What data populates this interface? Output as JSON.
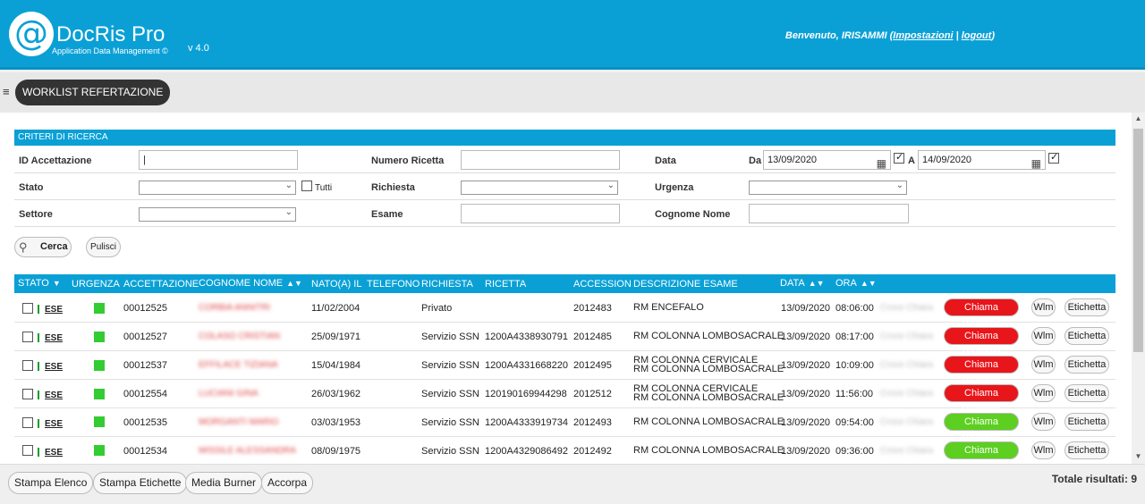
{
  "header": {
    "logo_symbol": "@",
    "app_name": "DocRis Pro",
    "tagline": "Application Data Management ©",
    "version": "v 4.0",
    "welcome_prefix": "Benvenuto, IRISAMMI (",
    "settings_link": "Impostazioni",
    "separator": " | ",
    "logout_link": "logout",
    "welcome_suffix": ")",
    "bg_color": "#0aa0d6"
  },
  "nav": {
    "menu_icon": "hamburger-icon",
    "worklist_label": "WORKLIST REFERTAZIONE"
  },
  "criteria": {
    "title": "CRITERI DI RICERCA",
    "id_accettazione_label": "ID Accettazione",
    "id_accettazione_value": "|",
    "numero_ricetta_label": "Numero Ricetta",
    "numero_ricetta_value": "",
    "data_label": "Data",
    "da_label": "Da",
    "da_value": "13/09/2020",
    "a_label": "A",
    "a_value": "14/09/2020",
    "stato_label": "Stato",
    "stato_value": "",
    "tutti_label": "Tutti",
    "richiesta_label": "Richiesta",
    "richiesta_value": "",
    "urgenza_label": "Urgenza",
    "urgenza_value": "",
    "settore_label": "Settore",
    "settore_value": "",
    "esame_label": "Esame",
    "esame_value": "",
    "cognome_nome_label": "Cognome Nome",
    "cognome_nome_value": "",
    "cerca_label": "Cerca",
    "pulisci_label": "Pulisci"
  },
  "table": {
    "headers": {
      "stato": "STATO",
      "urgenza": "URGENZA",
      "accettazione": "ACCETTAZIONE",
      "cognome_nome": "COGNOME NOME",
      "nato": "NATO(A) IL",
      "telefono": "TELEFONO",
      "richiesta": "RICHIESTA",
      "ricetta": "RICETTA",
      "accession": "ACCESSION",
      "descrizione": "DESCRIZIONE ESAME",
      "data": "DATA",
      "ora": "ORA"
    },
    "rows": [
      {
        "stato": "ESE",
        "accettazione": "00012525",
        "nome": "CORBIA ANNITRI",
        "nato": "11/02/2004",
        "telefono": "",
        "richiesta": "Privato",
        "ricetta": "",
        "accession": "2012483",
        "desc1": "RM ENCEFALO",
        "desc2": "",
        "data": "13/09/2020",
        "ora": "08:06:00",
        "operatore": "Croce Chiara",
        "chiama": "Chiama Paziente",
        "chiama_color": "#e8151a",
        "wlm": "Wlm",
        "etichetta": "Etichetta"
      },
      {
        "stato": "ESE",
        "accettazione": "00012527",
        "nome": "COLASO CRISTIAN",
        "nato": "25/09/1971",
        "telefono": "",
        "richiesta": "Servizio SSN",
        "ricetta": "1200A4338930791",
        "accession": "2012485",
        "desc1": "RM COLONNA LOMBOSACRALE",
        "desc2": "",
        "data": "13/09/2020",
        "ora": "08:17:00",
        "operatore": "Croce Chiara",
        "chiama": "Chiama Paziente",
        "chiama_color": "#e8151a",
        "wlm": "Wlm",
        "etichetta": "Etichetta"
      },
      {
        "stato": "ESE",
        "accettazione": "00012537",
        "nome": "EFFILACE TIZIANA",
        "nato": "15/04/1984",
        "telefono": "",
        "richiesta": "Servizio SSN",
        "ricetta": "1200A4331668220",
        "accession": "2012495",
        "desc1": "RM COLONNA CERVICALE",
        "desc2": "RM COLONNA LOMBOSACRALE",
        "data": "13/09/2020",
        "ora": "10:09:00",
        "operatore": "Croce Chiara",
        "chiama": "Chiama Paziente",
        "chiama_color": "#e8151a",
        "wlm": "Wlm",
        "etichetta": "Etichetta"
      },
      {
        "stato": "ESE",
        "accettazione": "00012554",
        "nome": "LUCIANI GINA",
        "nato": "26/03/1962",
        "telefono": "",
        "richiesta": "Servizio SSN",
        "ricetta": "120190169944298",
        "accession": "2012512",
        "desc1": "RM COLONNA CERVICALE",
        "desc2": "RM COLONNA LOMBOSACRALE",
        "data": "13/09/2020",
        "ora": "11:56:00",
        "operatore": "Croce Chiara",
        "chiama": "Chiama Paziente",
        "chiama_color": "#e8151a",
        "wlm": "Wlm",
        "etichetta": "Etichetta"
      },
      {
        "stato": "ESE",
        "accettazione": "00012535",
        "nome": "MORGANTI MARIO",
        "nato": "03/03/1953",
        "telefono": "",
        "richiesta": "Servizio SSN",
        "ricetta": "1200A4333919734",
        "accession": "2012493",
        "desc1": "RM COLONNA LOMBOSACRALE",
        "desc2": "",
        "data": "13/09/2020",
        "ora": "09:54:00",
        "operatore": "Croce Chiara",
        "chiama": "Chiama Paziente",
        "chiama_color": "#5ccf20",
        "wlm": "Wlm",
        "etichetta": "Etichetta"
      },
      {
        "stato": "ESE",
        "accettazione": "00012534",
        "nome": "MISSILE ALESSANDRA",
        "nato": "08/09/1975",
        "telefono": "",
        "richiesta": "Servizio SSN",
        "ricetta": "1200A4329086492",
        "accession": "2012492",
        "desc1": "RM COLONNA LOMBOSACRALE",
        "desc2": "",
        "data": "13/09/2020",
        "ora": "09:36:00",
        "operatore": "Croce Chiara",
        "chiama": "Chiama Paziente",
        "chiama_color": "#5ccf20",
        "wlm": "Wlm",
        "etichetta": "Etichetta"
      }
    ]
  },
  "footer": {
    "stampa_elenco": "Stampa Elenco",
    "stampa_etichette": "Stampa Etichette",
    "media_burner": "Media Burner",
    "accorpa": "Accorpa",
    "totale": "Totale risultati: 9"
  }
}
